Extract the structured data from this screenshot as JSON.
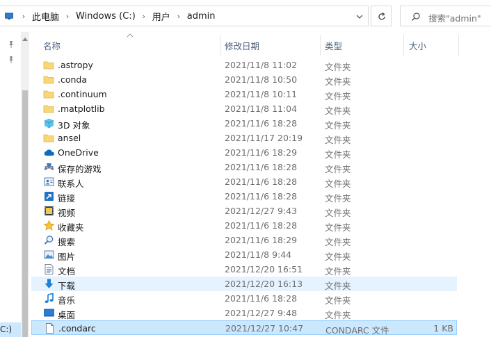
{
  "address_bar": {
    "breadcrumbs": [
      "此电脑",
      "Windows (C:)",
      "用户",
      "admin"
    ],
    "separator": "›"
  },
  "search": {
    "placeholder": "搜索\"admin\""
  },
  "nav": {
    "selected_label": "C:)"
  },
  "columns": {
    "name": "名称",
    "modified": "修改日期",
    "type": "类型",
    "size": "大小"
  },
  "files": [
    {
      "name": ".astropy",
      "modified": "2021/11/8 11:02",
      "type": "文件夹",
      "size": "",
      "icon": "folder-icon"
    },
    {
      "name": ".conda",
      "modified": "2021/11/8 10:50",
      "type": "文件夹",
      "size": "",
      "icon": "folder-icon"
    },
    {
      "name": ".continuum",
      "modified": "2021/11/8 10:11",
      "type": "文件夹",
      "size": "",
      "icon": "folder-icon"
    },
    {
      "name": ".matplotlib",
      "modified": "2021/11/8 11:04",
      "type": "文件夹",
      "size": "",
      "icon": "folder-icon"
    },
    {
      "name": "3D 对象",
      "modified": "2021/11/6 18:28",
      "type": "文件夹",
      "size": "",
      "icon": "3d-objects-icon"
    },
    {
      "name": "ansel",
      "modified": "2021/11/17 20:19",
      "type": "文件夹",
      "size": "",
      "icon": "folder-icon"
    },
    {
      "name": "OneDrive",
      "modified": "2021/11/6 18:29",
      "type": "文件夹",
      "size": "",
      "icon": "onedrive-cloud-icon"
    },
    {
      "name": "保存的游戏",
      "modified": "2021/11/6 18:28",
      "type": "文件夹",
      "size": "",
      "icon": "saved-games-icon"
    },
    {
      "name": "联系人",
      "modified": "2021/11/6 18:28",
      "type": "文件夹",
      "size": "",
      "icon": "contacts-icon"
    },
    {
      "name": "链接",
      "modified": "2021/11/6 18:28",
      "type": "文件夹",
      "size": "",
      "icon": "links-icon"
    },
    {
      "name": "视频",
      "modified": "2021/12/27 9:43",
      "type": "文件夹",
      "size": "",
      "icon": "videos-icon"
    },
    {
      "name": "收藏夹",
      "modified": "2021/11/6 18:28",
      "type": "文件夹",
      "size": "",
      "icon": "favorites-star-icon"
    },
    {
      "name": "搜索",
      "modified": "2021/11/6 18:29",
      "type": "文件夹",
      "size": "",
      "icon": "searches-icon"
    },
    {
      "name": "图片",
      "modified": "2021/11/8 9:44",
      "type": "文件夹",
      "size": "",
      "icon": "pictures-icon"
    },
    {
      "name": "文档",
      "modified": "2021/12/20 16:51",
      "type": "文件夹",
      "size": "",
      "icon": "documents-icon"
    },
    {
      "name": "下载",
      "modified": "2021/12/20 16:13",
      "type": "文件夹",
      "size": "",
      "icon": "downloads-arrow-icon"
    },
    {
      "name": "音乐",
      "modified": "2021/11/6 18:28",
      "type": "文件夹",
      "size": "",
      "icon": "music-note-icon"
    },
    {
      "name": "桌面",
      "modified": "2021/12/27 9:48",
      "type": "文件夹",
      "size": "",
      "icon": "desktop-icon"
    },
    {
      "name": ".condarc",
      "modified": "2021/12/27 10:47",
      "type": "CONDARC 文件",
      "size": "1 KB",
      "icon": "file-icon"
    }
  ],
  "hover_row_index": 15,
  "selected_row_index": 18
}
